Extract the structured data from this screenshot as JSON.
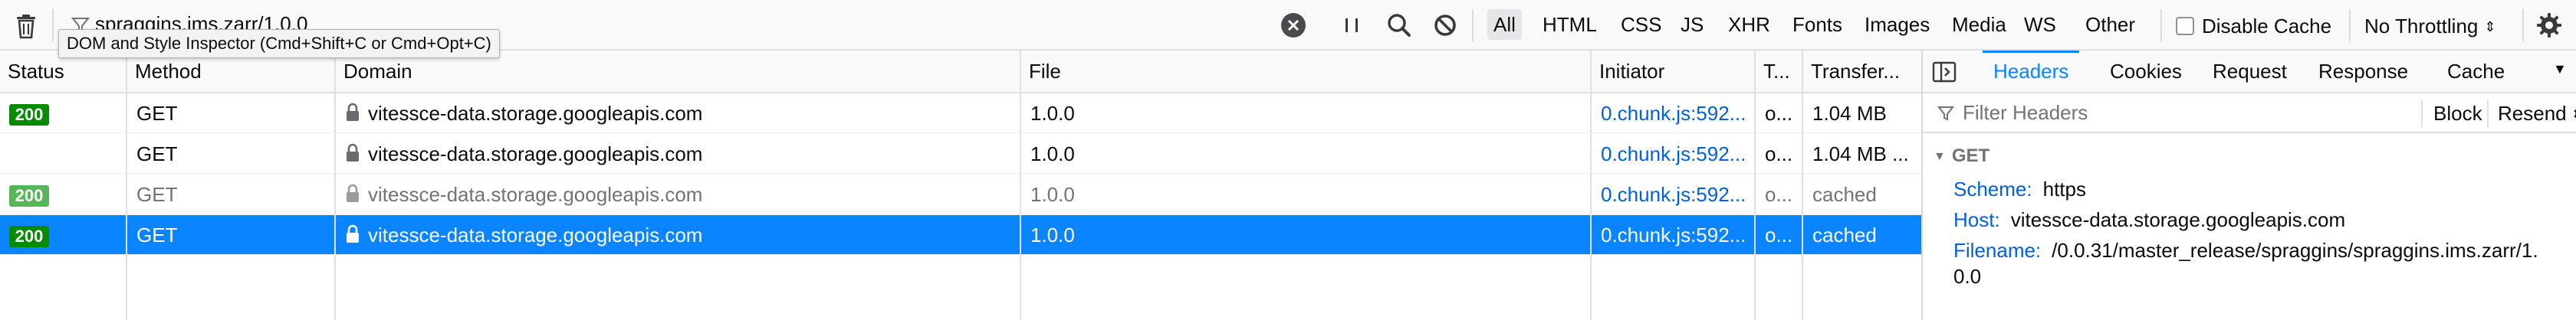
{
  "toolbar": {
    "filter_text": "spraggins.ims.zarr/1.0.0",
    "type_filters": [
      "All",
      "HTML",
      "CSS",
      "JS",
      "XHR",
      "Fonts",
      "Images",
      "Media",
      "WS",
      "Other"
    ],
    "active_type_filter": "All",
    "disable_cache_label": "Disable Cache",
    "disable_cache_checked": false,
    "throttling_label": "No Throttling",
    "throttling_arrows": "⇕"
  },
  "tooltip": {
    "text": "DOM and Style Inspector (Cmd+Shift+C or Cmd+Opt+C)"
  },
  "table": {
    "columns": {
      "status": "Status",
      "method": "Method",
      "domain": "Domain",
      "file": "File",
      "initiator": "Initiator",
      "type": "T...",
      "transferred": "Transfer..."
    },
    "rows": [
      {
        "status": "200",
        "method": "GET",
        "domain": "vitessce-data.storage.googleapis.com",
        "file": "1.0.0",
        "initiator": "0.chunk.js:592...",
        "type": "o...",
        "transferred": "1.04 MB",
        "cached": false,
        "selected": false
      },
      {
        "status": "",
        "method": "GET",
        "domain": "vitessce-data.storage.googleapis.com",
        "file": "1.0.0",
        "initiator": "0.chunk.js:592...",
        "type": "o...",
        "transferred": "1.04 MB ...",
        "cached": false,
        "selected": false
      },
      {
        "status": "200",
        "method": "GET",
        "domain": "vitessce-data.storage.googleapis.com",
        "file": "1.0.0",
        "initiator": "0.chunk.js:592...",
        "type": "o...",
        "transferred": "cached",
        "cached": true,
        "selected": false
      },
      {
        "status": "200",
        "method": "GET",
        "domain": "vitessce-data.storage.googleapis.com",
        "file": "1.0.0",
        "initiator": "0.chunk.js:592...",
        "type": "o...",
        "transferred": "cached",
        "cached": false,
        "selected": true
      }
    ]
  },
  "panel": {
    "tabs": [
      "Headers",
      "Cookies",
      "Request",
      "Response",
      "Cache"
    ],
    "active_tab": "Headers",
    "filter_placeholder": "Filter Headers",
    "block_label": "Block",
    "resend_label": "Resend",
    "resend_arrows": "⇕",
    "method_heading": "GET",
    "headers": [
      {
        "name": "Scheme:",
        "value": "https"
      },
      {
        "name": "Host:",
        "value": "vitessce-data.storage.googleapis.com"
      },
      {
        "name": "Filename:",
        "value": "/0.0.31/master_release/spraggins/spraggins.ims.zarr/1."
      },
      {
        "name": "",
        "value": "0.0"
      }
    ]
  }
}
